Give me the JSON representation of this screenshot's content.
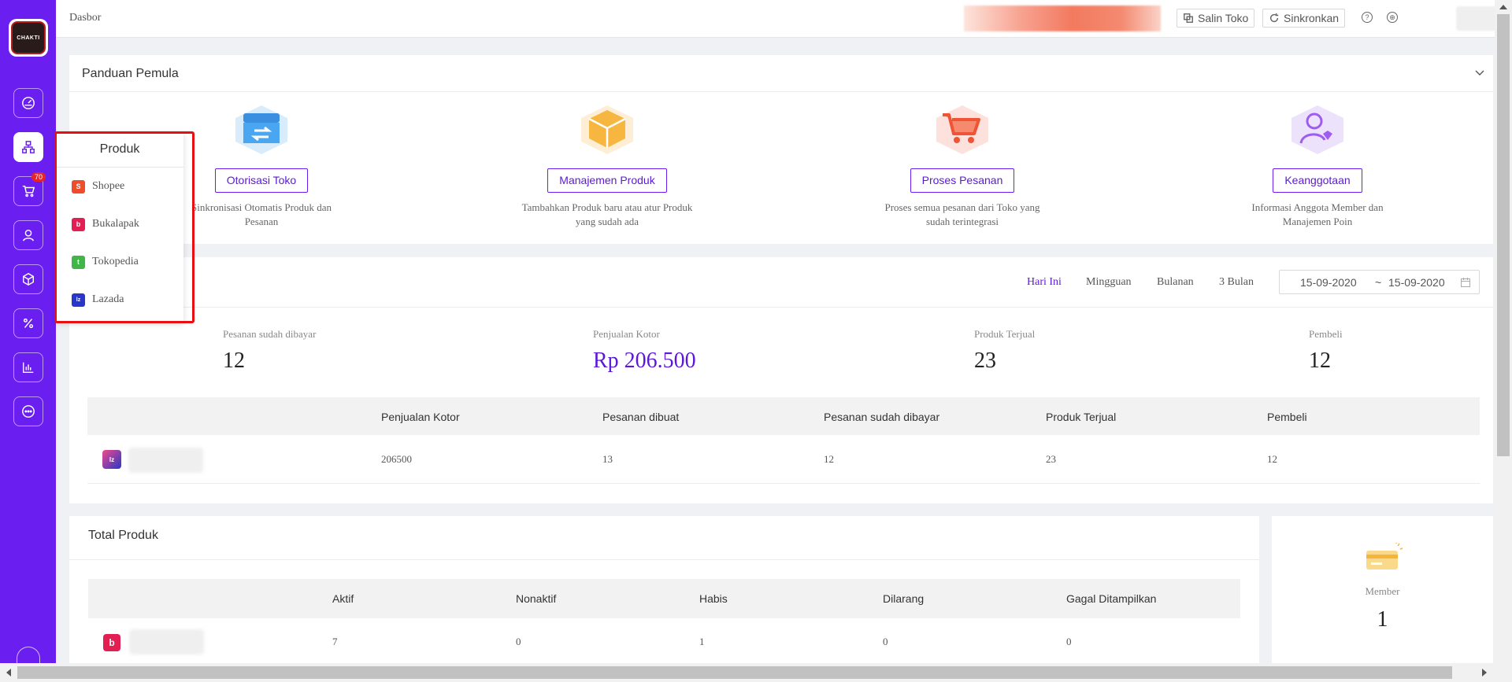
{
  "topbar": {
    "breadcrumb": "Dasbor",
    "copy_store_label": "Salin Toko",
    "sync_label": "Sinkronkan"
  },
  "sidebar": {
    "logo_text": "CHAKTI",
    "cart_badge": "70",
    "items": [
      "dashboard",
      "produk",
      "pesanan",
      "member",
      "inventaris",
      "promosi",
      "laporan",
      "obrolan"
    ]
  },
  "popup": {
    "title": "Produk",
    "items": [
      {
        "label": "Shopee",
        "color": "#ee4d2d",
        "glyph": "S"
      },
      {
        "label": "Bukalapak",
        "color": "#e31e52",
        "glyph": "b"
      },
      {
        "label": "Tokopedia",
        "color": "#42b549",
        "glyph": "t"
      },
      {
        "label": "Lazada",
        "color": "#2a36c8",
        "glyph": "lz"
      }
    ]
  },
  "guide": {
    "title": "Panduan Pemula",
    "steps": [
      {
        "button": "Otorisasi Toko",
        "desc": "Sinkronisasi Otomatis Produk dan Pesanan"
      },
      {
        "button": "Manajemen Produk",
        "desc": "Tambahkan Produk baru atau atur Produk yang sudah ada"
      },
      {
        "button": "Proses Pesanan",
        "desc": "Proses semua pesanan dari Toko yang sudah terintegrasi"
      },
      {
        "button": "Keanggotaan",
        "desc": "Informasi Anggota Member dan Manajemen Poin"
      }
    ]
  },
  "stats": {
    "periods": [
      "Hari Ini",
      "Mingguan",
      "Bulanan",
      "3 Bulan"
    ],
    "active_period": "Hari Ini",
    "date_from": "15-09-2020",
    "date_sep": "~",
    "date_to": "15-09-2020",
    "kpis": [
      {
        "label": "Pesanan sudah dibayar",
        "value": "12"
      },
      {
        "label": "Penjualan Kotor",
        "value": "Rp 206.500"
      },
      {
        "label": "Produk Terjual",
        "value": "23"
      },
      {
        "label": "Pembeli",
        "value": "12"
      }
    ],
    "table": {
      "headers": [
        "Penjualan Kotor",
        "Pesanan dibuat",
        "Pesanan sudah dibayar",
        "Produk Terjual",
        "Pembeli"
      ],
      "row": [
        "206500",
        "13",
        "12",
        "23",
        "12"
      ]
    }
  },
  "products": {
    "title": "Total Produk",
    "headers": [
      "Aktif",
      "Nonaktif",
      "Habis",
      "Dilarang",
      "Gagal Ditampilkan"
    ],
    "row": [
      "7",
      "0",
      "1",
      "0",
      "0"
    ]
  },
  "member": {
    "label": "Member",
    "value": "1"
  },
  "colors": {
    "brand": "#6a1ef0",
    "accent_text": "#5b18d9",
    "highlight": "#e60f12"
  }
}
